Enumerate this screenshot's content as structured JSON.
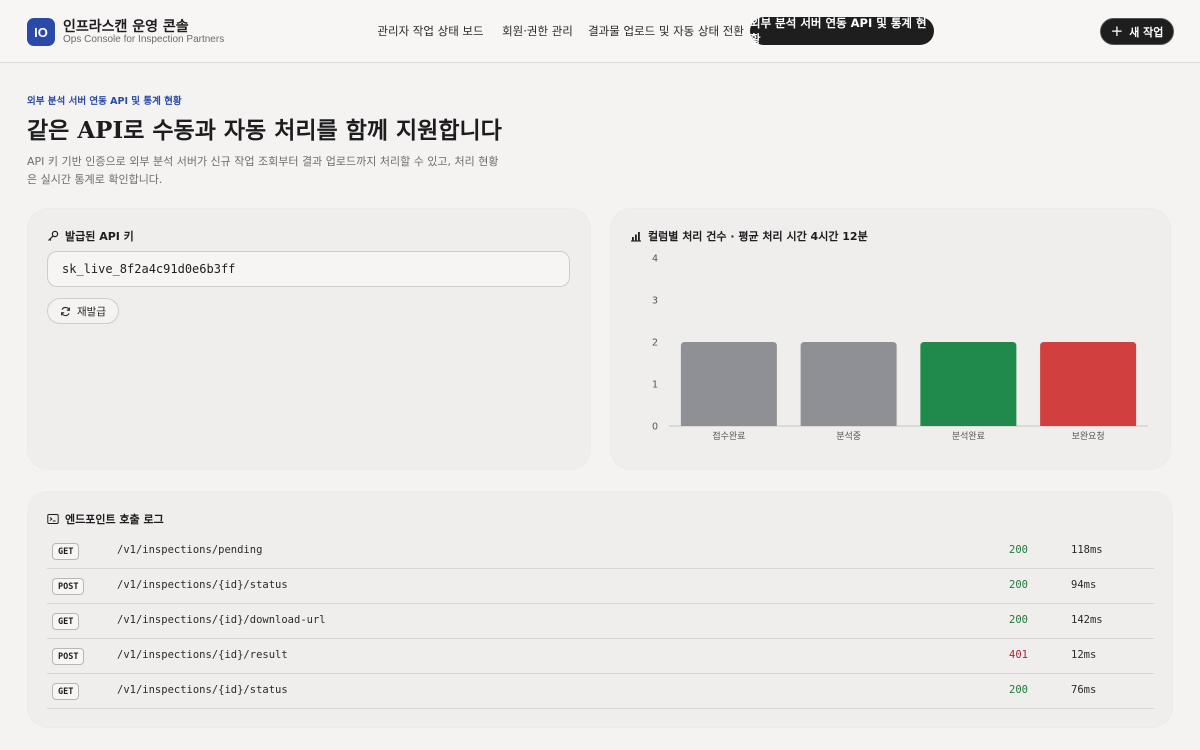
{
  "brand": {
    "badge": "IO",
    "title": "인프라스캔 운영 콘솔",
    "subtitle": "Ops Console for Inspection Partners"
  },
  "nav": {
    "items": [
      {
        "label": "관리자 작업 상태 보드"
      },
      {
        "label": "회원·권한 관리"
      },
      {
        "label": "결과물 업로드 및 자동 상태 전환"
      },
      {
        "label": "외부 분석 서버 연동 API 및 통계 현황",
        "active": true
      }
    ],
    "new_button": "새 작업"
  },
  "hero": {
    "eyebrow": "외부 분석 서버 연동 API 및 통계 현황",
    "title": "같은 API로 수동과 자동 처리를 함께 지원합니다",
    "description": "API 키 기반 인증으로 외부 분석 서버가 신규 작업 조회부터 결과 업로드까지 처리할 수 있고, 처리 현황은 실시간 통계로 확인합니다."
  },
  "api_key": {
    "heading": "발급된 API 키",
    "value": "sk_live_8f2a4c91d0e6b3ff",
    "reissue_label": "재발급"
  },
  "chart_card": {
    "heading": "컬럼별 처리 건수 · 평균 처리 시간 4시간 12분"
  },
  "chart_data": {
    "type": "bar",
    "title": "",
    "xlabel": "",
    "ylabel": "",
    "categories": [
      "접수완료",
      "분석중",
      "분석완료",
      "보완요청"
    ],
    "values": [
      2,
      2,
      2,
      2
    ],
    "colors": [
      "#8f9096",
      "#8f9096",
      "#1f8a4c",
      "#d13f3f"
    ],
    "ylim": [
      0,
      4
    ],
    "yticks": [
      0,
      1,
      2,
      3,
      4
    ],
    "grid": false,
    "legend": "none"
  },
  "log": {
    "heading": "엔드포인트 호출 로그",
    "rows": [
      {
        "method": "GET",
        "path": "/v1/inspections/pending",
        "status": "200",
        "time": "118ms"
      },
      {
        "method": "POST",
        "path": "/v1/inspections/{id}/status",
        "status": "200",
        "time": "94ms"
      },
      {
        "method": "GET",
        "path": "/v1/inspections/{id}/download-url",
        "status": "200",
        "time": "142ms"
      },
      {
        "method": "POST",
        "path": "/v1/inspections/{id}/result",
        "status": "401",
        "time": "12ms"
      },
      {
        "method": "GET",
        "path": "/v1/inspections/{id}/status",
        "status": "200",
        "time": "76ms"
      }
    ]
  },
  "colors": {
    "accent": "#2b49a8",
    "status_ok": "#1f7a3e",
    "status_error": "#a32a36",
    "dark": "#1e1e1e"
  }
}
